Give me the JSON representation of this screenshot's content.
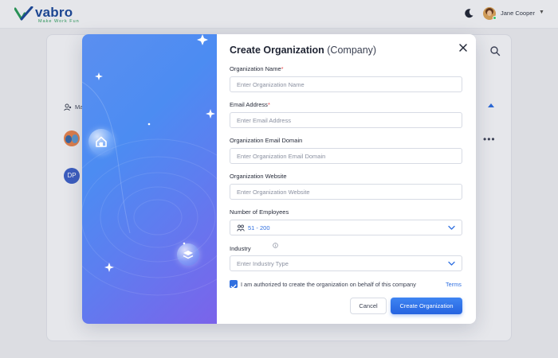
{
  "app": {
    "logo_text": "vabro",
    "tagline": "Make Work Fun"
  },
  "header": {
    "user_name": "Jane Cooper"
  },
  "background": {
    "column_label": "Ma",
    "avatar_initials": "DP"
  },
  "modal": {
    "title_main": "Create Organization",
    "title_sub": "(Company)",
    "fields": {
      "org_name": {
        "label": "Organization Name",
        "required": "*",
        "placeholder": "Enter Organization Name",
        "value": ""
      },
      "email": {
        "label": "Email Address",
        "required": "*",
        "placeholder": "Enter Email Address",
        "value": ""
      },
      "domain": {
        "label": "Organization Email Domain",
        "placeholder": "Enter Organization Email Domain",
        "value": ""
      },
      "website": {
        "label": "Organization Website",
        "placeholder": "Enter Organization Website",
        "value": ""
      },
      "employees": {
        "label": "Number of Employees",
        "value": "51 - 200"
      },
      "industry": {
        "label": "Industry",
        "placeholder": "Enter Industry Type"
      }
    },
    "consent": {
      "text": "I am authorized to create the organization on behalf of this company",
      "link": "Terms",
      "checked": true
    },
    "buttons": {
      "cancel": "Cancel",
      "create": "Create Organization"
    }
  },
  "colors": {
    "accent": "#2f6fe0",
    "required": "#e5484d",
    "hero_start": "#4c8cf2",
    "hero_end": "#7b63ea"
  },
  "icons": [
    "vabro-logo-icon",
    "moon-icon",
    "chevron-down-icon",
    "search-icon",
    "people-icon",
    "more-icon",
    "close-icon",
    "home-icon",
    "layers-icon",
    "employees-icon",
    "info-icon",
    "check-icon"
  ]
}
